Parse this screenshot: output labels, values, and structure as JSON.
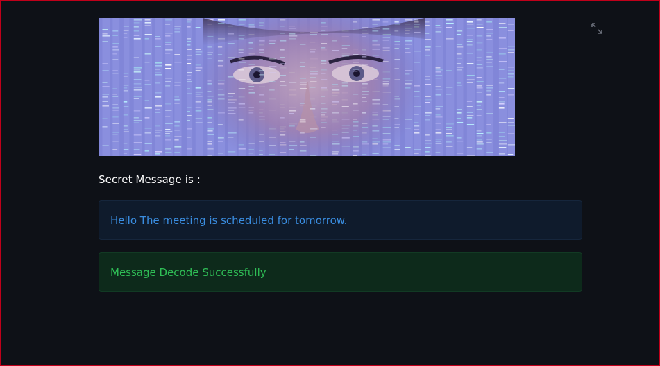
{
  "secret": {
    "label": "Secret Message is :",
    "message": "Hello The meeting is scheduled for tomorrow."
  },
  "status": {
    "text": "Message Decode Successfully"
  },
  "toolbar": {
    "expand_icon": "fullscreen-expand-icon"
  },
  "colors": {
    "background": "#0e1117",
    "info_text": "#3a8de0",
    "info_bg": "#0f1b2c",
    "success_text": "#2fbe56",
    "success_bg": "#0d2a1b",
    "frame_border": "#c0001a"
  }
}
